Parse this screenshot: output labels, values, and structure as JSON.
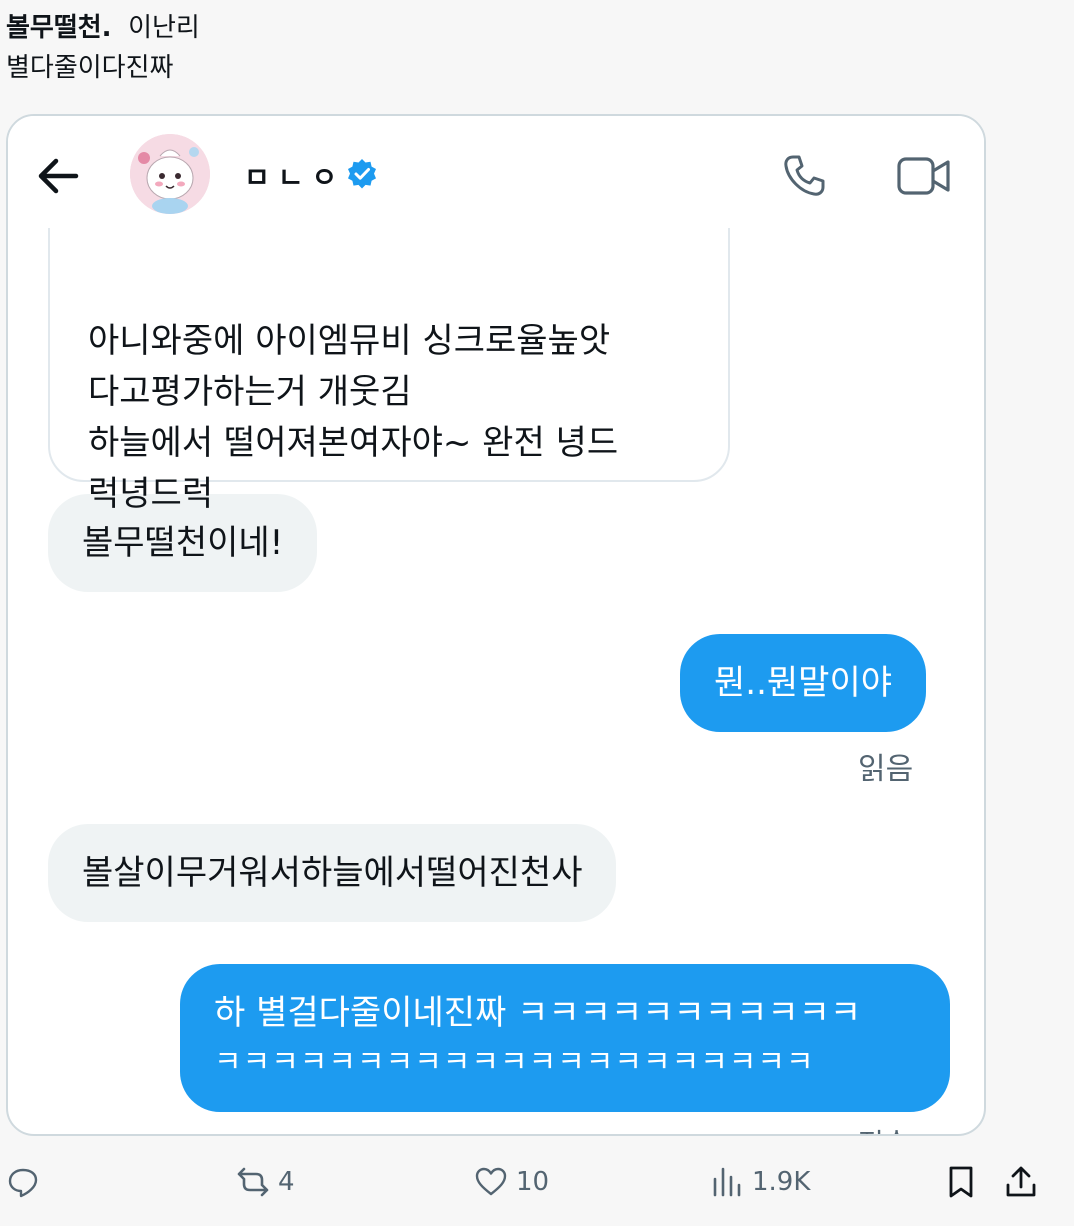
{
  "tweet": {
    "bold_text": "볼무떨천.",
    "line1_rest": "이난리",
    "line2": "별다줄이다진짜"
  },
  "dm": {
    "contact_name": "ㅁㄴㅇ",
    "quoted_lines": [
      "아니와중에 아이엠뮤비 싱크로율높앗",
      "다고평가하는거 개웃김",
      "하늘에서 떨어져본여자야~ 완전 녕드",
      "럭녕드럭"
    ],
    "messages": [
      {
        "direction": "in",
        "text": "볼무떨천이네!"
      },
      {
        "direction": "out",
        "text": "뭔..뭔말이야"
      },
      {
        "direction": "in",
        "text": "볼살이무거워서하늘에서떨어진천사"
      },
      {
        "direction": "out",
        "line1": "하 별걸다줄이네진짜 ㅋㅋㅋㅋㅋㅋㅋㅋㅋㅋㅋ",
        "line2": "ㅋㅋㅋㅋㅋㅋㅋㅋㅋㅋㅋㅋㅋㅋㅋㅋㅋㅋㅋㅋㅋ"
      }
    ],
    "read_label": "읽음",
    "sent_label": "전송",
    "icons": [
      "back-arrow-icon",
      "avatar",
      "verified-badge-icon",
      "phone-icon",
      "video-icon"
    ],
    "colors": {
      "outgoing_bubble": "#1d9bf0",
      "incoming_bubble": "#eff3f4",
      "verified": "#1d9bf0"
    }
  },
  "actions": {
    "reply_count": "",
    "retweet_count": "4",
    "like_count": "10",
    "views_count": "1.9K"
  }
}
